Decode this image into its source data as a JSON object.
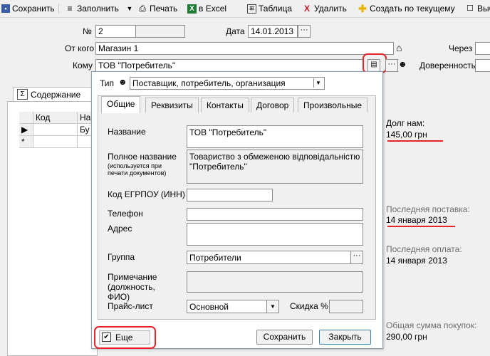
{
  "toolbar": {
    "save": "Сохранить",
    "fill": "Заполнить",
    "print": "Печать",
    "excel": "в Excel",
    "table": "Таблица",
    "delete": "Удалить",
    "create_from_current": "Создать по текущему",
    "select_partial": "Выб"
  },
  "form": {
    "number_label": "№",
    "number_value": "2",
    "date_label": "Дата",
    "date_value": "14.01.2013",
    "from_label": "От кого",
    "from_value": "Магазин 1",
    "via_label": "Через",
    "to_label": "Кому",
    "to_value": "ТОВ \"Потребитель\"",
    "power_of_attorney_label": "Доверенность"
  },
  "content_tab": {
    "label": "Содержание",
    "columns": [
      "Код",
      "На"
    ],
    "row1_name_partial": "Бу",
    "new_row_marker": "*"
  },
  "popup": {
    "type_label": "Тип",
    "type_value": "Поставщик, потребитель, организация",
    "tabs": [
      "Общие",
      "Реквизиты",
      "Контакты",
      "Договор",
      "Произвольные"
    ],
    "name_label": "Название",
    "name_value": "ТОВ \"Потребитель\"",
    "full_name_label": "Полное название",
    "full_name_note": "(используется при печати документов)",
    "full_name_value": "Товариство з обмеженою відповідальністю \"Потребитель\"",
    "edrpou_label": "Код ЕГРПОУ (ИНН)",
    "edrpou_value": "",
    "phone_label": "Телефон",
    "phone_value": "",
    "address_label": "Адрес",
    "address_value": "",
    "group_label": "Группа",
    "group_value": "Потребители",
    "note_label": "Примечание (должность, ФИО)",
    "note_value": "",
    "price_list_label": "Прайс-лист",
    "price_list_value": "Основной",
    "discount_label": "Скидка %",
    "discount_value": "",
    "more_label": "Еще",
    "more_checked": true,
    "save_button": "Сохранить",
    "close_button": "Закрыть"
  },
  "right_panel": {
    "debt_label": "Долг нам:",
    "debt_value": "145,00 грн",
    "last_delivery_label": "Последняя поставка:",
    "last_delivery_value": "14 января 2013",
    "last_payment_label": "Последняя оплата:",
    "last_payment_value": "14 января 2013",
    "total_purchases_label": "Общая сумма покупок:",
    "total_purchases_value": "290,00 грн"
  },
  "colors": {
    "highlight": "#e8232a",
    "excel_green": "#1e7b34",
    "delete_red": "#c0182a",
    "create_yellow": "#e8b400"
  }
}
